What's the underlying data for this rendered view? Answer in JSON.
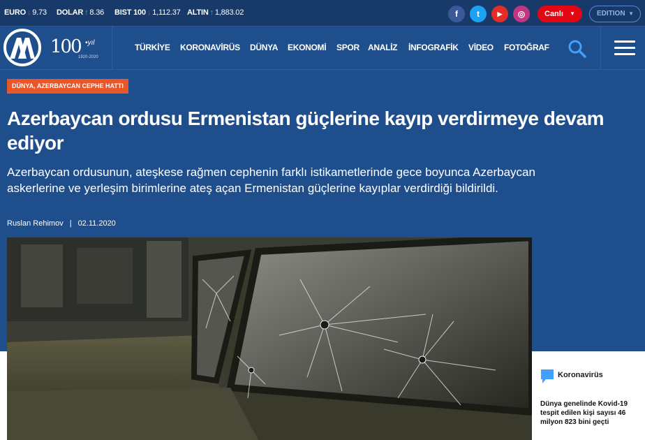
{
  "ticker": [
    {
      "name": "EURO",
      "dir": "down",
      "value": "9.73"
    },
    {
      "name": "DOLAR",
      "dir": "up",
      "value": "8.36"
    },
    {
      "name": "BIST 100",
      "dir": "down",
      "value": "1,112.37"
    },
    {
      "name": "ALTIN",
      "dir": "up",
      "value": "1,883.02"
    }
  ],
  "social": {
    "facebook": "f",
    "twitter": "t",
    "youtube": "▶",
    "instagram": "◎"
  },
  "header_buttons": {
    "live_label": "Canlı",
    "edition_label": "EDITION"
  },
  "logo": {
    "hundred": "100",
    "yil": "•yıl",
    "years": "1920-2020"
  },
  "nav": [
    "TÜRKİYE",
    "KORONAVİRÜS",
    "DÜNYA",
    "EKONOMİ",
    "SPOR",
    "ANALİZ",
    "İNFOGRAFİK",
    "VİDEO",
    "FOTOĞRAF"
  ],
  "article": {
    "category": "DÜNYA, AZERBAYCAN CEPHE HATTI",
    "headline": "Azerbaycan ordusu Ermenistan güçlerine kayıp verdirmeye devam ediyor",
    "summary": "Azerbaycan ordusunun, ateşkese rağmen cephenin farklı istikametlerinde gece boyunca Azerbaycan askerlerine ve yerleşim birimlerine ateş açan Ermenistan güçlerine kayıplar verdirdiği bildirildi.",
    "author": "Ruslan Rehimov",
    "separator": "|",
    "date": "02.11.2020"
  },
  "sidebar": {
    "label": "Koronavirüs",
    "text": "Dünya genelinde Kovid-19 tespit edilen kişi sayısı 46 milyon 823 bini geçti"
  },
  "colors": {
    "brand_blue": "#1f4e8c",
    "accent_red": "#e30613",
    "category_orange": "#e8562a",
    "facebook": "#3b5998",
    "twitter": "#1da1f2",
    "youtube": "#e52d27",
    "instagram": "#c13584"
  }
}
